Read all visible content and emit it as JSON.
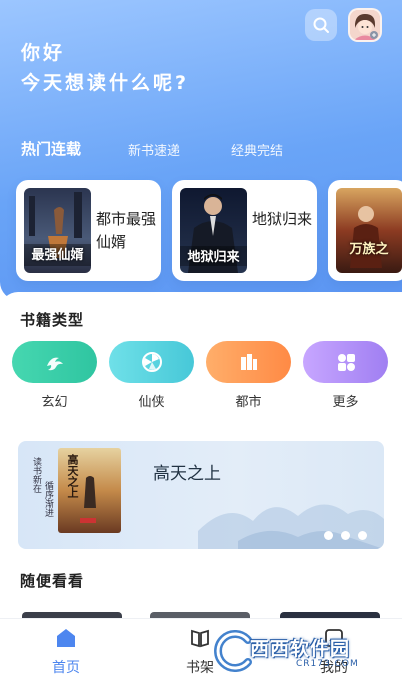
{
  "header": {
    "greeting_line1": "你好",
    "greeting_line2": "今天想读什么呢?",
    "search_icon": "search-icon",
    "avatar_icon": "avatar"
  },
  "tabs": [
    {
      "label": "热门连载",
      "active": true
    },
    {
      "label": "新书速递",
      "active": false
    },
    {
      "label": "经典完结",
      "active": false
    }
  ],
  "featured_books": [
    {
      "title": "都市最强仙婿",
      "cover_text": "最强仙婿",
      "cover_color": "#3a4a6a"
    },
    {
      "title": "地狱归来",
      "cover_text": "地狱归来",
      "cover_color": "#1d2a4a"
    },
    {
      "title": "",
      "cover_text": "万族之",
      "cover_color": "#6b2a1a"
    }
  ],
  "categories_section": {
    "title": "书籍类型"
  },
  "categories": [
    {
      "label": "玄幻",
      "color_from": "#46d7b0",
      "color_to": "#2fc5a1",
      "icon": "dragon-icon"
    },
    {
      "label": "仙侠",
      "color_from": "#6fe0e8",
      "color_to": "#47c8d8",
      "icon": "fan-icon"
    },
    {
      "label": "都市",
      "color_from": "#ffae6a",
      "color_to": "#ff8a45",
      "icon": "buildings-icon"
    },
    {
      "label": "更多",
      "color_from": "#c7a6ff",
      "color_to": "#a07ff2",
      "icon": "grid-icon"
    }
  ],
  "banner": {
    "title": "高天之上",
    "vertical_text_1": "读书新在",
    "vertical_text_2": "循序渐进",
    "cover_text": "高天之上"
  },
  "random_section": {
    "title": "随便看看"
  },
  "bottom_nav": [
    {
      "label": "首页",
      "icon": "home-icon",
      "active": true
    },
    {
      "label": "书架",
      "icon": "bookshelf-icon",
      "active": false
    },
    {
      "label": "我的",
      "icon": "user-icon",
      "active": false
    }
  ],
  "watermark": {
    "text": "西西软件园",
    "sub": "CR173.COM"
  },
  "colors": {
    "accent": "#4d86ef",
    "hero_top": "#9cc6ff",
    "hero_bottom": "#5b95f2"
  }
}
